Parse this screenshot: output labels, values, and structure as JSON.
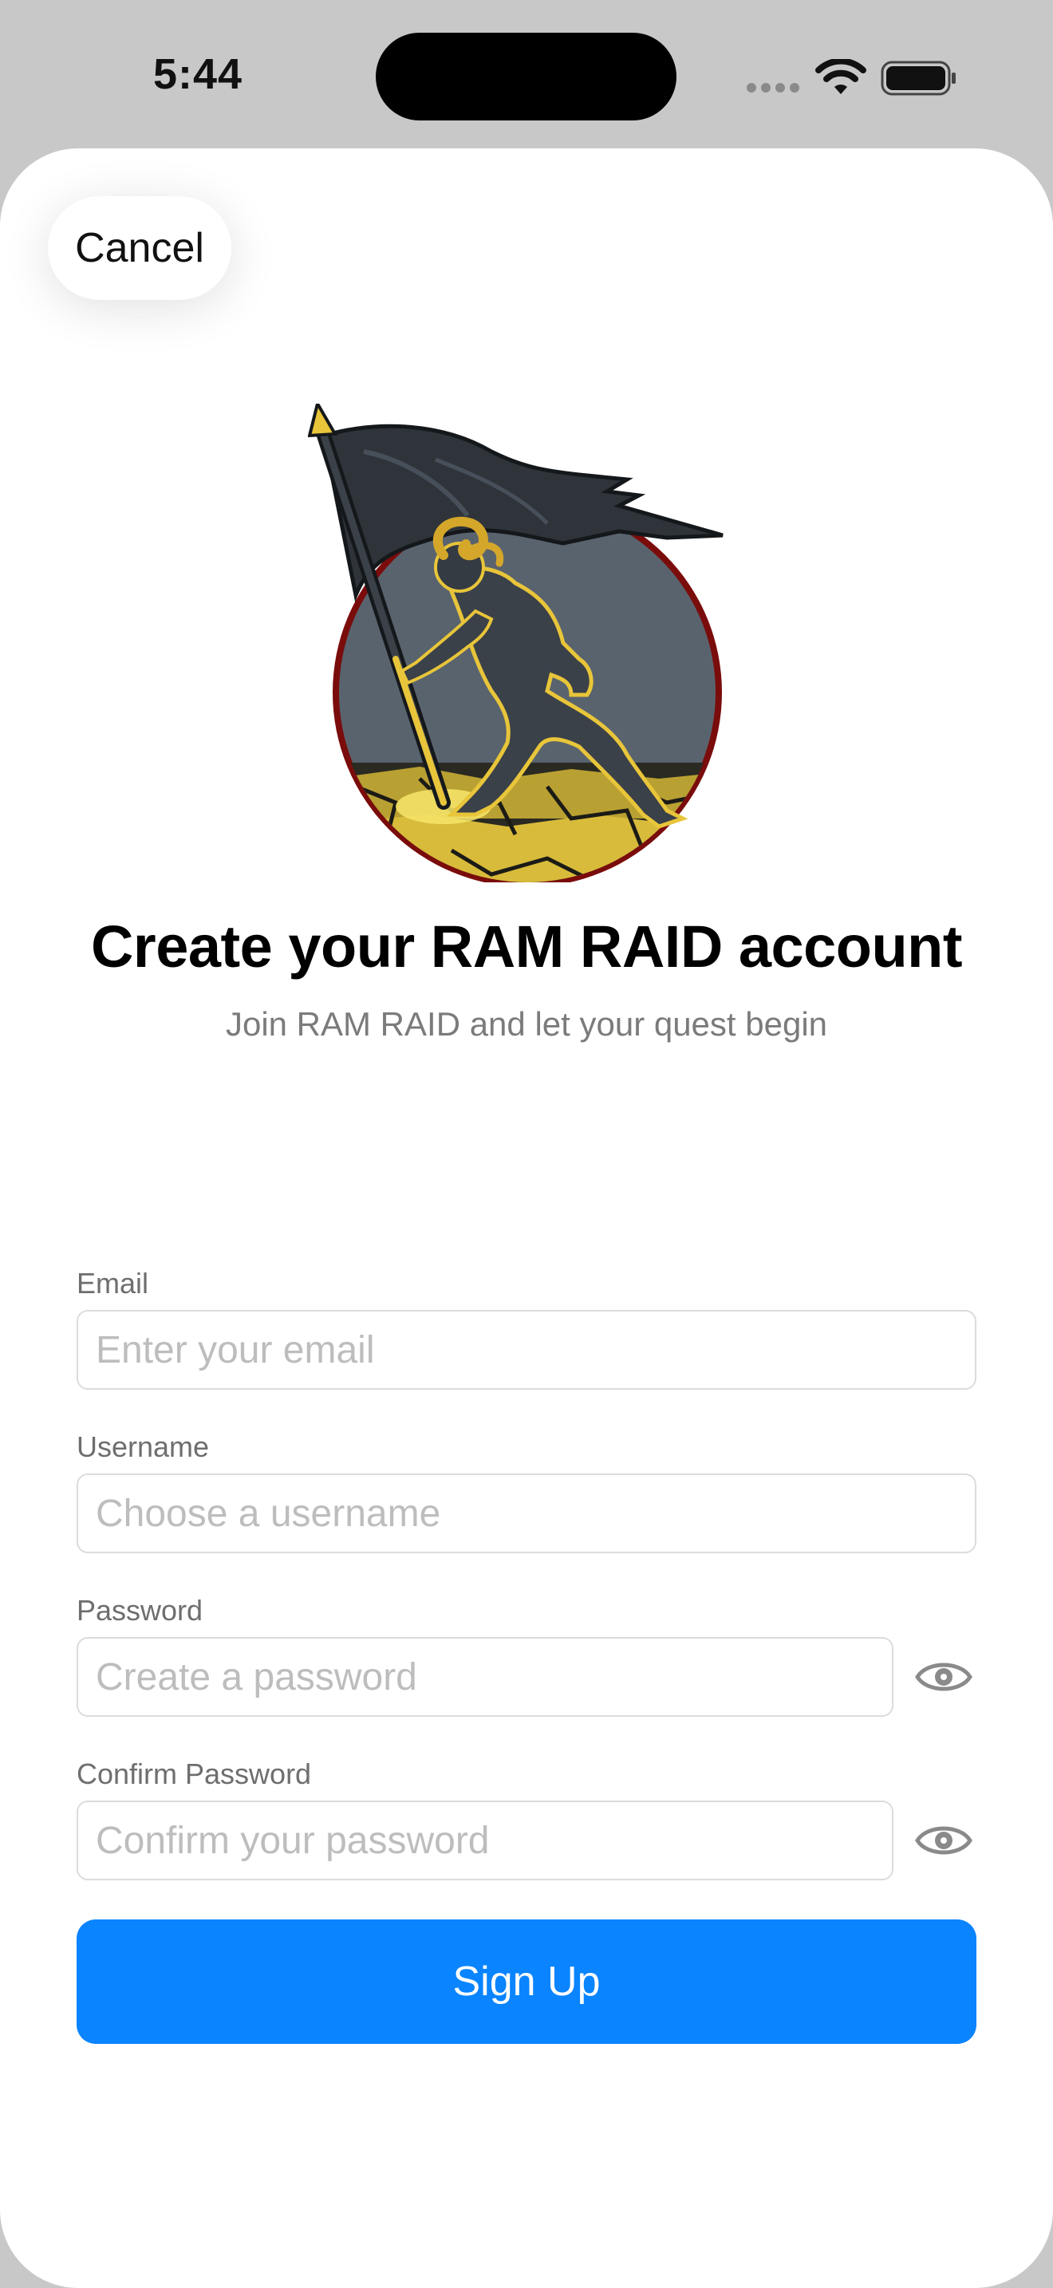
{
  "status_bar": {
    "time": "5:44"
  },
  "header": {
    "cancel_label": "Cancel"
  },
  "logo": {
    "icon": "ram-warrior-flag-logo"
  },
  "title": "Create your RAM RAID account",
  "subtitle": "Join RAM RAID and let your quest begin",
  "form": {
    "email": {
      "label": "Email",
      "placeholder": "Enter your email",
      "value": ""
    },
    "username": {
      "label": "Username",
      "placeholder": "Choose a username",
      "value": ""
    },
    "password": {
      "label": "Password",
      "placeholder": "Create a password",
      "value": ""
    },
    "confirm_password": {
      "label": "Confirm Password",
      "placeholder": "Confirm your password",
      "value": ""
    },
    "submit_label": "Sign Up"
  },
  "colors": {
    "accent": "#0a84ff",
    "logo_ring": "#7a0c0c",
    "logo_gold": "#e8c53a",
    "logo_dark": "#3b4148"
  }
}
